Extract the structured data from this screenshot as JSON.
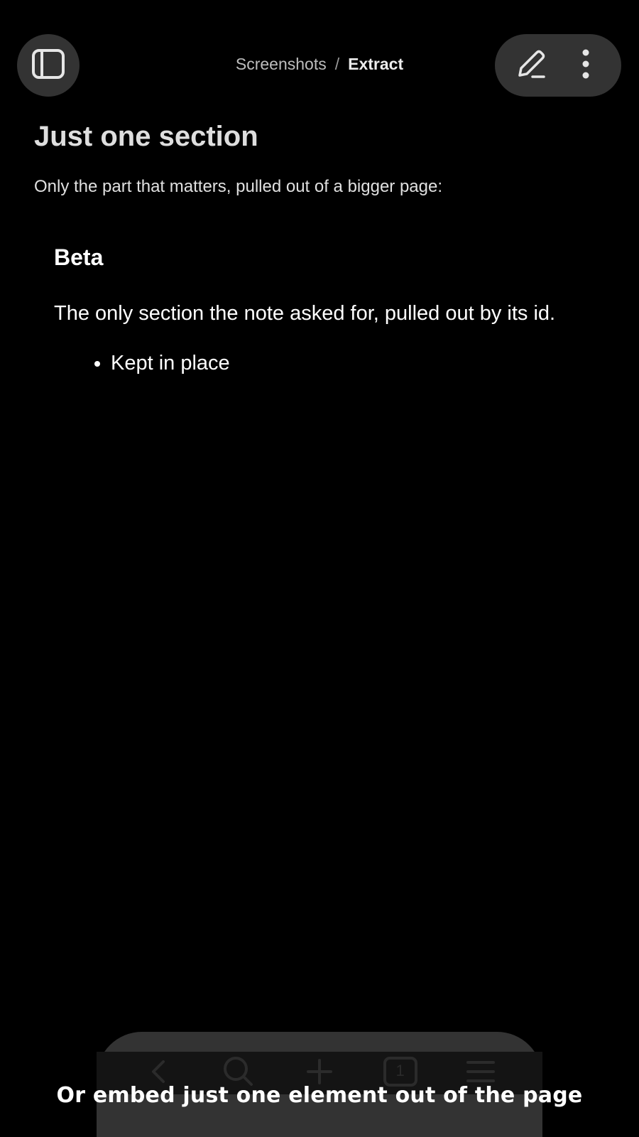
{
  "breadcrumb": {
    "parent": "Screenshots",
    "separator": "/",
    "current": "Extract"
  },
  "content": {
    "title": "Just one section",
    "subtitle": "Only the part that matters, pulled out of a bigger page:",
    "embed": {
      "heading": "Beta",
      "paragraph": "The only section the note asked for, pulled out by its id.",
      "list_items": [
        "Kept in place"
      ]
    }
  },
  "browser_bar": {
    "tab_count": "1",
    "icons": [
      "back-icon",
      "search-icon",
      "plus-icon",
      "tabs-icon",
      "menu-icon"
    ]
  },
  "caption": "Or embed just one element out of the page",
  "colors": {
    "background": "#000000",
    "button_bg": "#333333",
    "text_primary": "#ffffff",
    "text_muted": "#bdbdbd"
  }
}
